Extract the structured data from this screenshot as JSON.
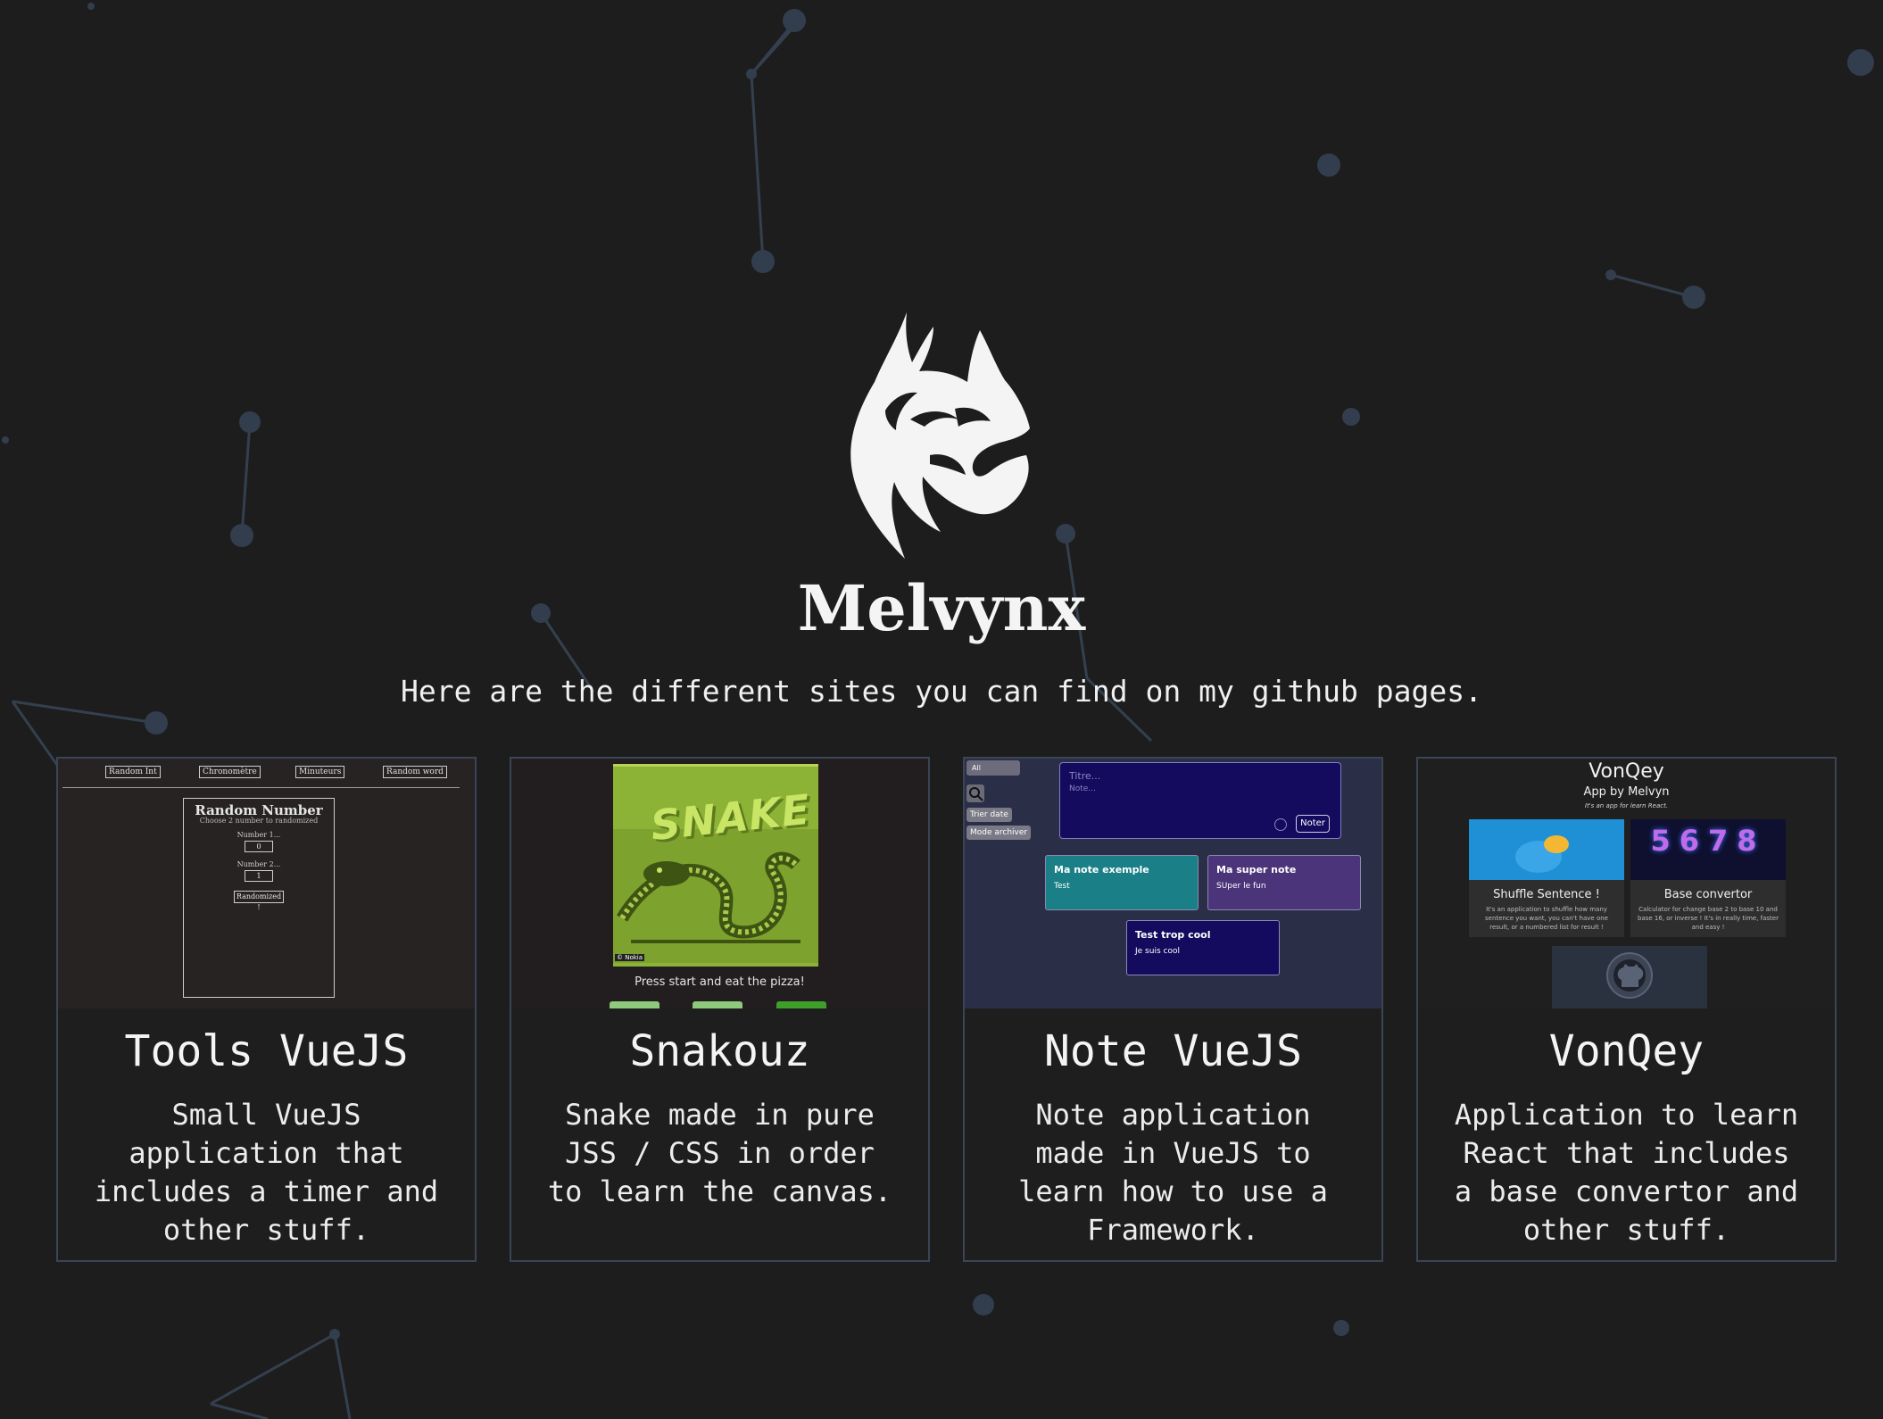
{
  "site": {
    "name": "Melvynx",
    "subtitle": "Here are the different sites you can find on my github pages.",
    "logo_icon": "lynx-head-icon"
  },
  "cards": [
    {
      "title": "Tools VueJS",
      "description": "Small VueJS application that includes a timer and other stuff.",
      "preview": {
        "nav": [
          "Random Int",
          "Chronomètre",
          "Minuteurs",
          "Random word"
        ],
        "heading": "Random Number",
        "subheading": "Choose 2 number to randomized",
        "label1": "Number 1...",
        "value1": "0",
        "label2": "Number 2...",
        "value2": "1",
        "button": "Randomized !"
      }
    },
    {
      "title": "Snakouz",
      "description": "Snake made in pure JSS / CSS in order to learn the canvas.",
      "preview": {
        "logo": "SNAKE",
        "badge": "© Nokia",
        "caption": "Press start and eat the pizza!"
      }
    },
    {
      "title": "Note VueJS",
      "description": "Note application made in VueJS to learn how to use a Framework.",
      "preview": {
        "filter": "All",
        "sort_button": "Trier date",
        "archive_button": "Mode archiver",
        "title_placeholder": "Titre...",
        "note_placeholder": "Note...",
        "submit": "Noter",
        "notes": [
          {
            "title": "Ma note exemple",
            "body": "Test",
            "color": "#1a7f86"
          },
          {
            "title": "Ma super note",
            "body": "SUper le fun",
            "color": "#4b3479"
          },
          {
            "title": "Test trop cool",
            "body": "Je suis cool",
            "color": "#140a5e"
          }
        ]
      }
    },
    {
      "title": "VonQey",
      "description": "Application to learn React that includes a base convertor and other stuff.",
      "preview": {
        "title": "VonQey",
        "subtitle": "App by Melvyn",
        "intro": "It's an app for learn React.",
        "tiles": [
          {
            "name": "Shuffle Sentence !",
            "desc": "It's an application to shuffle how many sentence you want, you can't have one result, or a numbered list for result !"
          },
          {
            "name": "Base convertor",
            "desc": "Calculator for change base 2 to base 10 and base 16, or inverse ! It's in really time, faster and easy !"
          }
        ],
        "numbers": "5678",
        "github_icon": "github-icon"
      }
    }
  ]
}
